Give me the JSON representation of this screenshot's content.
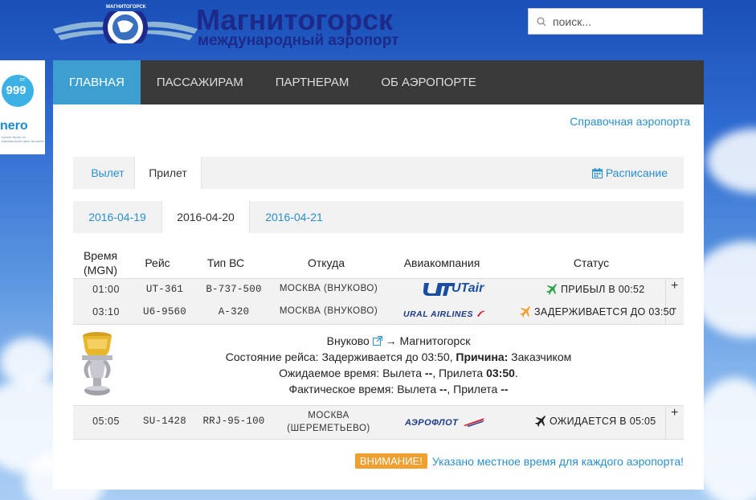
{
  "header": {
    "title": "Магнитогорск",
    "subtitle": "международный аэропорт",
    "emblem_text": "МАГНИТОГОРСК",
    "search_placeholder": "поиск..."
  },
  "side_widget": {
    "prefix": "от",
    "price": "999",
    "currency": "₽",
    "brand_fragment": "nero",
    "small_text": "Купите билет по минимальной цене на сайте"
  },
  "nav": {
    "items": [
      {
        "label": "ГЛАВНАЯ",
        "active": true
      },
      {
        "label": "ПАССАЖИРАМ",
        "active": false
      },
      {
        "label": "ПАРТНЕРАМ",
        "active": false
      },
      {
        "label": "ОБ АЭРОПОРТЕ",
        "active": false
      }
    ]
  },
  "help_link": "Справочная аэропорта",
  "tabs": {
    "departure": "Вылет",
    "arrival": "Прилет",
    "schedule": "Расписание"
  },
  "dates": [
    "2016-04-19",
    "2016-04-20",
    "2016-04-21"
  ],
  "table": {
    "headers": {
      "time_line1": "Время",
      "time_line2": "(MGN)",
      "flight": "Рейс",
      "aircraft": "Тип ВС",
      "from": "Откуда",
      "airline": "Авиакомпания",
      "status": "Статус"
    },
    "rows": [
      {
        "time": "01:00",
        "flight": "UT-361",
        "aircraft": "B-737-500",
        "from": "МОСКВА (ВНУКОВО)",
        "airline": "UTair",
        "status": "ПРИБЫЛ В 00:52",
        "toggle": "+"
      },
      {
        "time": "03:10",
        "flight": "U6-9560",
        "aircraft": "A-320",
        "from": "МОСКВА (ВНУКОВО)",
        "airline": "URAL AIRLINES",
        "status": "ЗАДЕРЖИВАЕТСЯ ДО 03:50",
        "toggle": "-"
      },
      {
        "time": "05:05",
        "flight": "SU-1428",
        "aircraft": "RRJ-95-100",
        "from_line1": "МОСКВА",
        "from_line2": "(ШЕРЕМЕТЬЕВО)",
        "airline": "АЭРОФЛОТ",
        "status": "ОЖИДАЕТСЯ В 05:05",
        "toggle": "+"
      }
    ]
  },
  "detail": {
    "route_from": "Внуково",
    "route_arrow": "→",
    "route_to": "Магнитогорск",
    "state_label": "Состояние рейса:",
    "state_value": "Задерживается до 03:50,",
    "reason_label": "Причина:",
    "reason_value": "Заказчиком",
    "expected_label": "Ожидаемое время: Вылета",
    "expected_dep": "--",
    "expected_mid": ", Прилета",
    "expected_arr": "03:50",
    "expected_end": ".",
    "actual_label": "Фактическое время: Вылета",
    "actual_dep": "--",
    "actual_mid": ", Прилета",
    "actual_arr": "--"
  },
  "notice": {
    "badge": "ВНИМАНИЕ!",
    "text": "Указано местное время для каждого аэропорта!"
  },
  "colors": {
    "accent": "#3d9fd0",
    "link": "#2a8fcf",
    "nav_bg": "#3a3a3a",
    "arrived_plane": "#2ea24a",
    "delayed_plane": "#f0a030",
    "expected_plane": "#222222",
    "notice_badge": "#f0a030"
  }
}
